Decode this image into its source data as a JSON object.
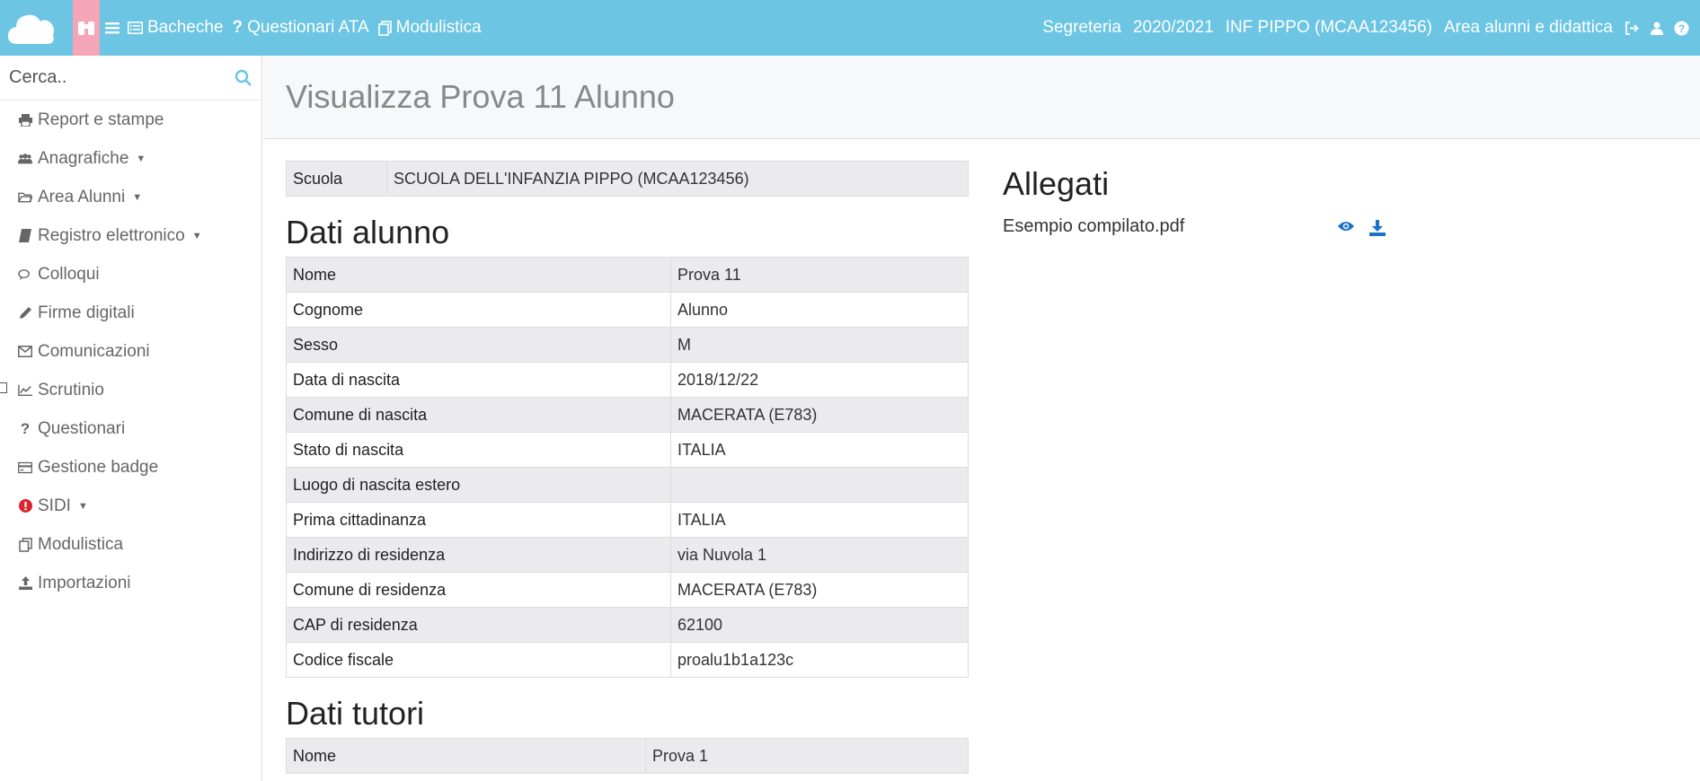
{
  "topbar": {
    "menu": [
      {
        "label": "Bacheche",
        "icon": "list-icon"
      },
      {
        "label": "Questionari ATA",
        "icon": "question-icon"
      },
      {
        "label": "Modulistica",
        "icon": "copy-icon"
      }
    ],
    "right": {
      "office": "Segreteria",
      "year": "2020/2021",
      "school": "INF PIPPO (MCAA123456)",
      "area": "Area alunni e didattica"
    },
    "colors": {
      "bar": "#6bc5e3",
      "highlight": "#f4a6b8"
    }
  },
  "sidebar": {
    "search_placeholder": "Cerca..",
    "items": [
      {
        "label": "Report e stampe",
        "icon": "print-icon",
        "caret": ""
      },
      {
        "label": "Anagrafiche",
        "icon": "users-icon",
        "caret": "▼"
      },
      {
        "label": "Area Alunni",
        "icon": "folder-icon",
        "caret": "▼"
      },
      {
        "label": "Registro elettronico",
        "icon": "book-icon",
        "caret": "▼"
      },
      {
        "label": "Colloqui",
        "icon": "comments-icon",
        "caret": ""
      },
      {
        "label": "Firme digitali",
        "icon": "pencil-icon",
        "caret": ""
      },
      {
        "label": "Comunicazioni",
        "icon": "envelope-icon",
        "caret": ""
      },
      {
        "label": "Scrutinio",
        "icon": "chart-icon",
        "caret": ""
      },
      {
        "label": "Questionari",
        "icon": "question-icon",
        "caret": ""
      },
      {
        "label": "Gestione badge",
        "icon": "card-icon",
        "caret": ""
      },
      {
        "label": "SIDI",
        "icon": "alert-icon",
        "caret": "▼"
      },
      {
        "label": "Modulistica",
        "icon": "copy-icon",
        "caret": ""
      },
      {
        "label": "Importazioni",
        "icon": "upload-icon",
        "caret": ""
      }
    ]
  },
  "main": {
    "title": "Visualizza Prova 11 Alunno",
    "school_label": "Scuola",
    "school_value": "SCUOLA DELL'INFANZIA PIPPO (MCAA123456)",
    "student_heading": "Dati alunno",
    "student": [
      {
        "label": "Nome",
        "value": "Prova 11"
      },
      {
        "label": "Cognome",
        "value": "Alunno"
      },
      {
        "label": "Sesso",
        "value": "M"
      },
      {
        "label": "Data di nascita",
        "value": "2018/12/22"
      },
      {
        "label": "Comune di nascita",
        "value": "MACERATA (E783)"
      },
      {
        "label": "Stato di nascita",
        "value": "ITALIA"
      },
      {
        "label": "Luogo di nascita estero",
        "value": ""
      },
      {
        "label": "Prima cittadinanza",
        "value": "ITALIA"
      },
      {
        "label": "Indirizzo di residenza",
        "value": "via Nuvola 1"
      },
      {
        "label": "Comune di residenza",
        "value": "MACERATA (E783)"
      },
      {
        "label": "CAP di residenza",
        "value": "62100"
      },
      {
        "label": "Codice fiscale",
        "value": "proalu1b1a123c"
      }
    ],
    "tutor_heading": "Dati tutori",
    "tutor": [
      {
        "label": "Nome",
        "value": "Prova 1"
      }
    ],
    "attachments_heading": "Allegati",
    "attachments": [
      {
        "name": "Esempio compilato.pdf"
      }
    ],
    "colors": {
      "action": "#1a73c8"
    }
  }
}
